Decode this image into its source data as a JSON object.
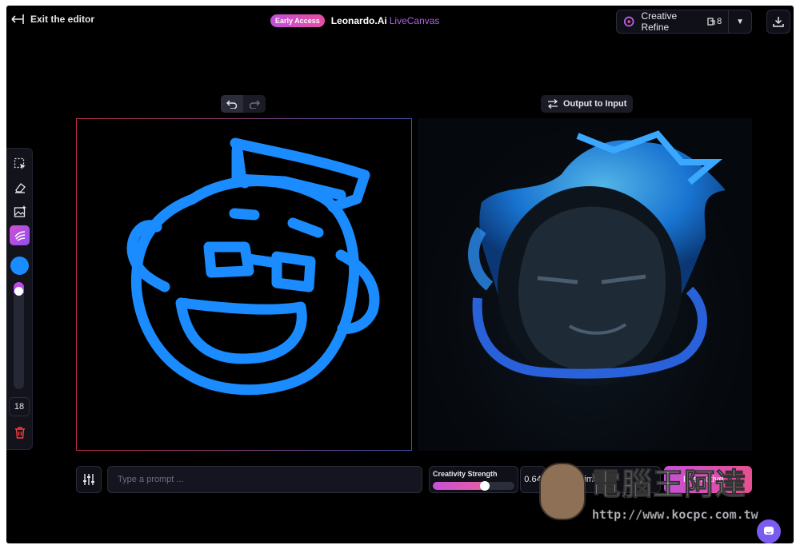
{
  "header": {
    "exit_label": "Exit the editor",
    "badge": "Early Access",
    "brand": "Leonardo.Ai",
    "product": "LiveCanvas",
    "refine_label": "Creative Refine",
    "refine_count": "8"
  },
  "canvas_controls": {
    "output_to_input": "Output to Input"
  },
  "toolbar": {
    "brush_color": "#1a8cff",
    "brush_size_fraction": 0.05,
    "brush_size": "18"
  },
  "bottom": {
    "prompt_placeholder": "Type a prompt ...",
    "strength_label": "Creativity Strength",
    "strength_value": "0.64",
    "strength_fraction": 0.64,
    "style_label": "Anime",
    "interactive_label": "Interactive"
  },
  "watermark": {
    "title": "電腦王阿達",
    "url": "http://www.kocpc.com.tw"
  },
  "colors": {
    "accent": "#c84fd8",
    "sketch_blue": "#1a8cff"
  }
}
